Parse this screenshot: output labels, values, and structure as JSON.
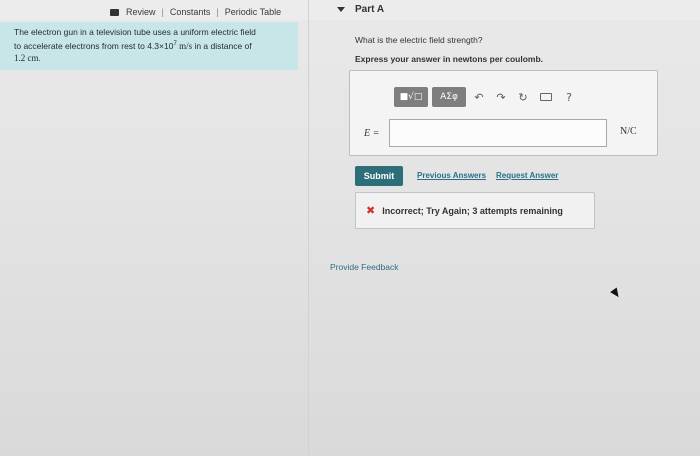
{
  "header": {
    "review": "Review",
    "constants": "Constants",
    "periodic_table": "Periodic Table",
    "separator": "|"
  },
  "problem": {
    "line1": "The electron gun in a television tube uses a uniform electric field",
    "line2_prefix": "to accelerate electrons from rest to 4.3×10",
    "line2_exp": "7",
    "line2_unit": " m/s",
    "line2_suffix": " in a distance of",
    "line3": "1.2 cm",
    "line3_end": "."
  },
  "part": {
    "title": "Part A",
    "question": "What is the electric field strength?",
    "instruction": "Express your answer in newtons per coulomb."
  },
  "toolbar": {
    "sqrt_label": "■√□",
    "greek_label": "ΑΣφ",
    "undo_label": "↶",
    "redo_label": "↷",
    "reset_label": "↻",
    "help_label": "?"
  },
  "answer": {
    "variable": "E =",
    "value": "",
    "unit": "N/C"
  },
  "actions": {
    "submit": "Submit",
    "previous_answers": "Previous Answers",
    "request_answer": "Request Answer"
  },
  "feedback": {
    "message": "Incorrect; Try Again; 3 attempts remaining"
  },
  "footer": {
    "provide_feedback": "Provide Feedback"
  },
  "colors": {
    "problem_bg": "#c8e6e8",
    "submit_bg": "#2d6e78",
    "link": "#2a6f88",
    "error": "#d0322c"
  }
}
